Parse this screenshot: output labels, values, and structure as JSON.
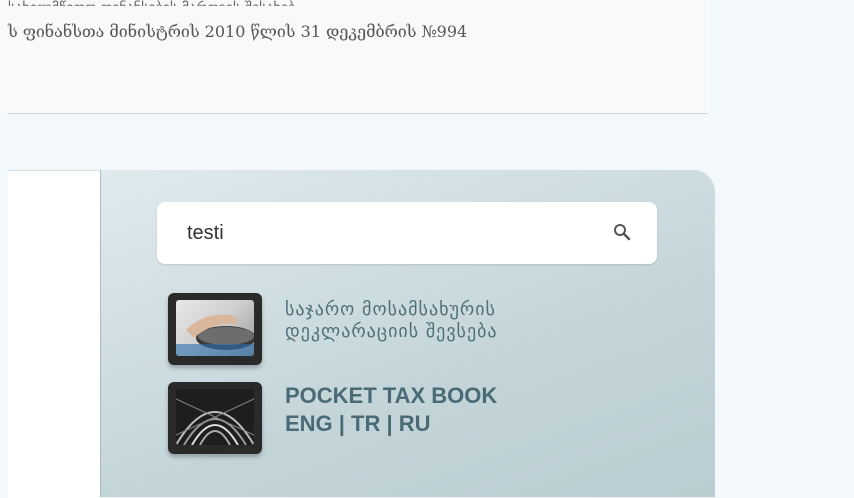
{
  "top_text": {
    "clipped_line": "სახელმწიფო ფინანსების მართვის შესახებ",
    "line": "ს ფინანსთა მინისტრის 2010 წლის 31 დეკემბრის №994"
  },
  "search": {
    "value": "testi",
    "placeholder": ""
  },
  "promo_items": [
    {
      "label_line1": "საჯარო მოსამსახურის",
      "label_line2": "დეკლარაციის შევსება"
    },
    {
      "label_line1": "POCKET TAX BOOK",
      "label_line2": "ENG | TR | RU"
    }
  ],
  "colors": {
    "panel": "#c4d5d9",
    "link": "#4e6e78"
  }
}
